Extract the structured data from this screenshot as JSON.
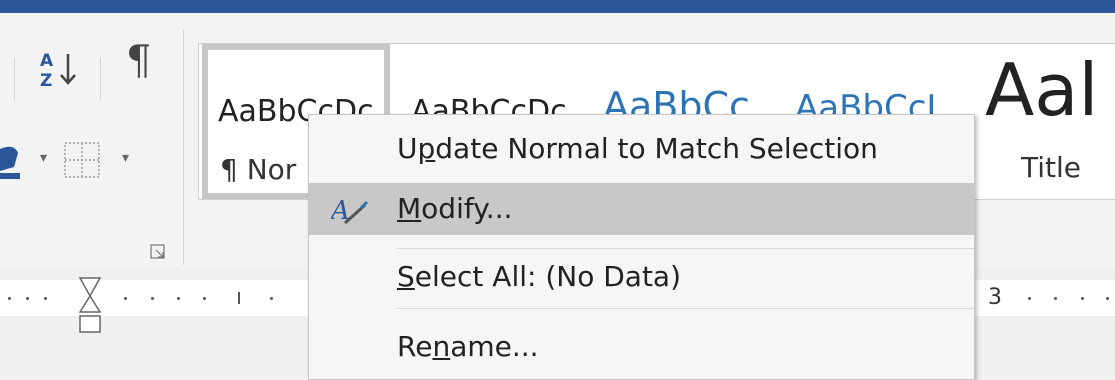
{
  "styles_gallery": {
    "tiles": [
      {
        "sample": "AaBbCcDc",
        "name": "¶ Nor"
      },
      {
        "sample": "AaBbCcDc",
        "name": ""
      },
      {
        "sample": "AaBbCc",
        "name": ""
      },
      {
        "sample": "AaBbCcL",
        "name": ""
      },
      {
        "sample": "Aal",
        "name": "Title"
      }
    ]
  },
  "ruler": {
    "number_3": "3"
  },
  "context_menu": {
    "items": [
      {
        "label": "Update Normal to Match Selection",
        "mnemonic_index": 1
      },
      {
        "label": "Modify...",
        "mnemonic_index": 0
      },
      {
        "label": "Select All: (No Data)",
        "mnemonic_index": 0
      },
      {
        "label": "Rename...",
        "mnemonic_index": 2
      }
    ]
  },
  "colors": {
    "title_bar": "#2b579a",
    "heading_blue": "#2e74b5",
    "menu_highlight": "#c8c8c8"
  }
}
